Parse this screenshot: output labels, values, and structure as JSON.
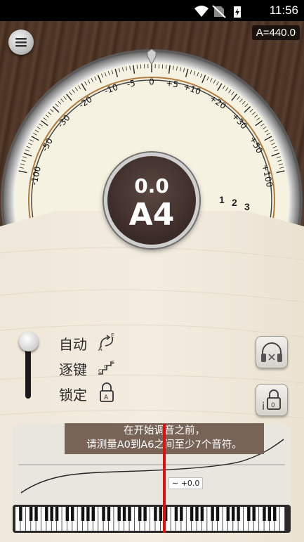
{
  "status_bar": {
    "time": "11:56"
  },
  "reference_pitch": "A=440.0",
  "tuner": {
    "cents": "0.0",
    "note": "A4",
    "scale_labels": [
      "-100",
      "-50",
      "-30",
      "-20",
      "-10",
      "-5",
      "0",
      "+5",
      "+10",
      "+20",
      "+30",
      "+50",
      "+100"
    ],
    "octave_numbers": [
      "1",
      "2",
      "3"
    ]
  },
  "modes": [
    {
      "label": "自动"
    },
    {
      "label": "逐键"
    },
    {
      "label": "锁定"
    }
  ],
  "measurement": {
    "hint_line1": "在开始调音之前，",
    "hint_line2": "请测量A0到A6之间至少7个音符。",
    "offset": "+0.0"
  },
  "colors": {
    "needle": "#e01010",
    "wood": "#4a3325",
    "panel": "#e9e6df"
  },
  "icons": [
    "menu-icon",
    "headphones-icon",
    "lock-info-icon",
    "auto-mode-icon",
    "step-mode-icon",
    "lock-mode-icon"
  ]
}
